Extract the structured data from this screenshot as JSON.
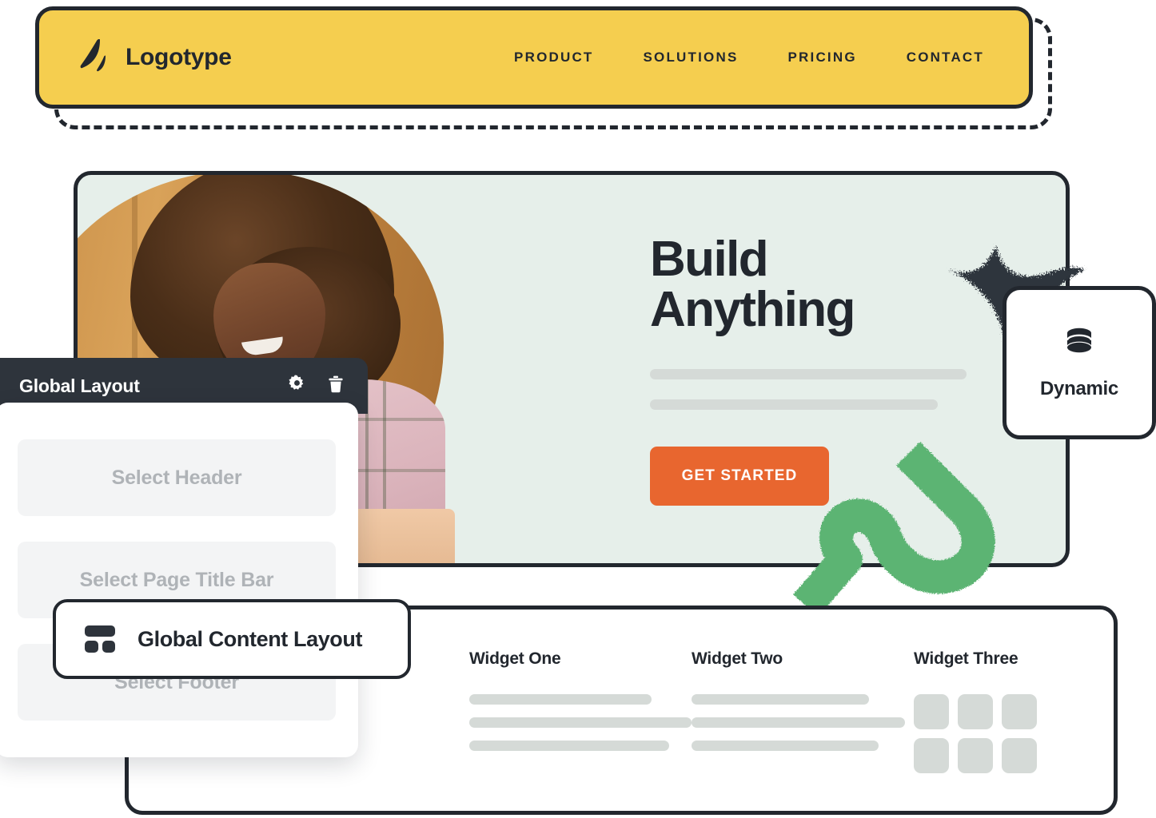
{
  "colors": {
    "brand_yellow": "#F5CE4F",
    "ink": "#22272E",
    "panel_dark": "#2E343C",
    "hero_bg": "#E6EFEA",
    "cta_orange": "#E8662F",
    "accent_green": "#5CB473",
    "placeholder_grey": "#D5DAD7",
    "slot_grey": "#F3F4F5",
    "slot_text": "#AFB3B7"
  },
  "navbar": {
    "logo_icon": "leaf-logo-icon",
    "brand_name": "Logotype",
    "links": [
      {
        "label": "PRODUCT"
      },
      {
        "label": "SOLUTIONS"
      },
      {
        "label": "PRICING"
      },
      {
        "label": "CONTACT"
      }
    ]
  },
  "hero": {
    "photo_alt": "Smiling woman with curly hair working on a laptop",
    "title_line_1": "Build",
    "title_line_2": "Anything",
    "cta_label": "GET STARTED"
  },
  "dynamic_card": {
    "icon": "database-icon",
    "label": "Dynamic"
  },
  "widgets": [
    {
      "title": "Widget One",
      "body_type": "lines",
      "line_widths": [
        "82%",
        "100%",
        "90%"
      ]
    },
    {
      "title": "Widget Two",
      "body_type": "lines",
      "line_widths": [
        "80%",
        "96%",
        "84%"
      ]
    },
    {
      "title": "Widget Three",
      "body_type": "grid",
      "grid_cells": 6
    }
  ],
  "global_layout_panel": {
    "title": "Global Layout",
    "settings_icon": "gear-icon",
    "delete_icon": "trash-icon",
    "slots": [
      {
        "label": "Select Header"
      },
      {
        "label": "Select Page Title Bar"
      },
      {
        "label": "Select Footer"
      }
    ]
  },
  "global_content_layout_chip": {
    "icon": "layout-blocks-icon",
    "label": "Global Content Layout"
  }
}
